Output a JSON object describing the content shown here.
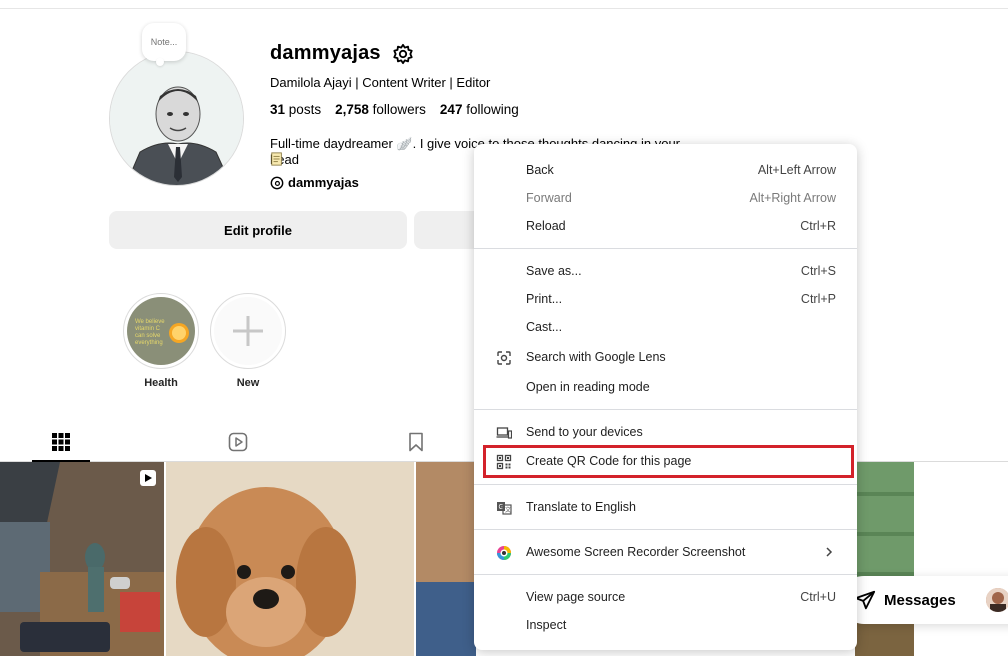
{
  "profile": {
    "note": "Note...",
    "username": "dammyajas",
    "fullname": "Damilola Ajayi | Content Writer | Editor",
    "posts_count": "31",
    "posts_label": "posts",
    "followers_count": "2,758",
    "followers_label": "followers",
    "following_count": "247",
    "following_label": "following",
    "bio": "Full-time daydreamer 🪽. I give voice to those thoughts dancing in your head",
    "threads_handle": "dammyajas",
    "edit_label": "Edit profile"
  },
  "highlights": [
    {
      "label": "Health"
    },
    {
      "label": "New"
    }
  ],
  "messages_label": "Messages",
  "context_menu": {
    "items": [
      {
        "label": "Back",
        "shortcut": "Alt+Left Arrow"
      },
      {
        "label": "Forward",
        "shortcut": "Alt+Right Arrow"
      },
      {
        "label": "Reload",
        "shortcut": "Ctrl+R"
      },
      {
        "label": "Save as...",
        "shortcut": "Ctrl+S"
      },
      {
        "label": "Print...",
        "shortcut": "Ctrl+P"
      },
      {
        "label": "Cast..."
      },
      {
        "label": "Search with Google Lens",
        "icon": "google-lens-icon"
      },
      {
        "label": "Open in reading mode"
      },
      {
        "label": "Send to your devices",
        "icon": "devices-icon"
      },
      {
        "label": "Create QR Code for this page",
        "icon": "qr-code-icon"
      },
      {
        "label": "Translate to English",
        "icon": "translate-icon"
      },
      {
        "label": "Awesome Screen Recorder  Screenshot",
        "icon": "extension-icon"
      },
      {
        "label": "View page source",
        "shortcut": "Ctrl+U"
      },
      {
        "label": "Inspect"
      }
    ]
  },
  "colors": {
    "highlight_border": "#d3222a",
    "button_bg": "#efefef"
  }
}
